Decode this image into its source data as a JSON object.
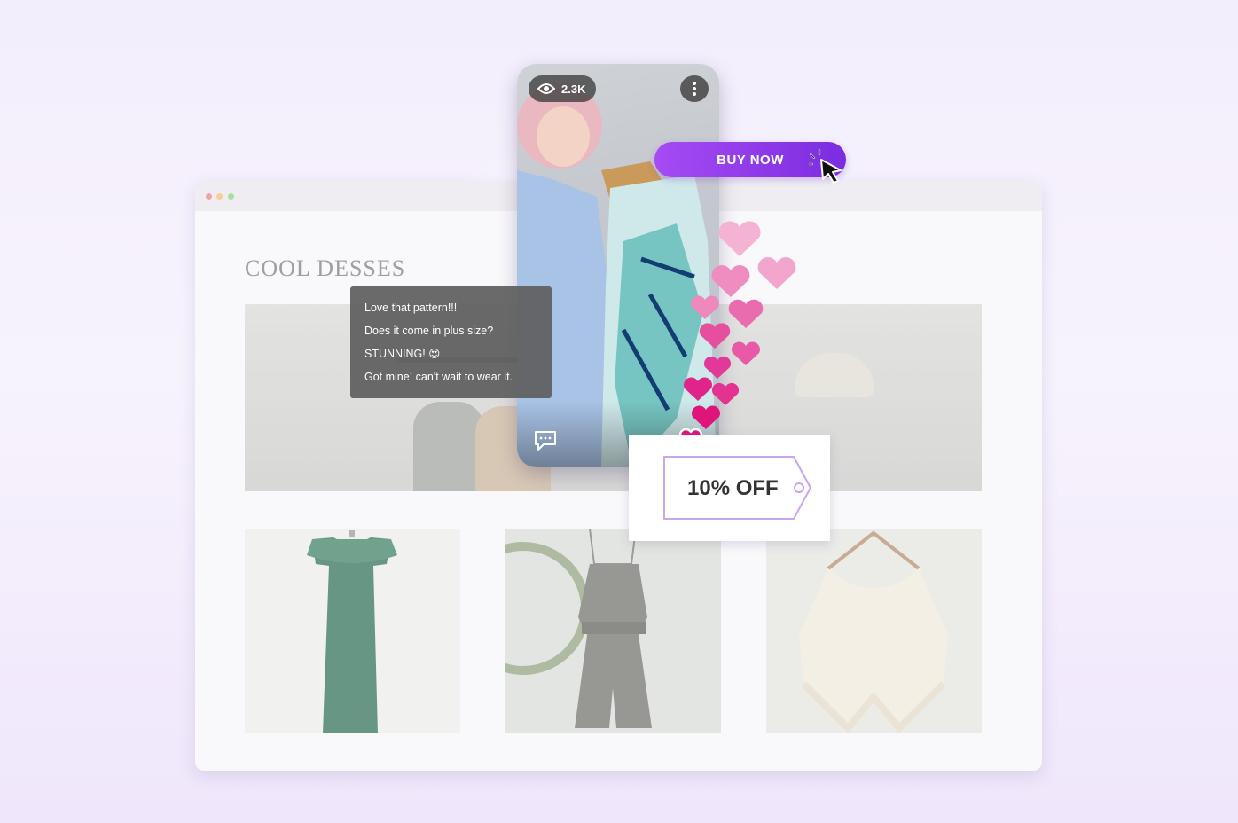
{
  "browser": {
    "page_title": "COOL DESSES"
  },
  "phone": {
    "views": "2.3K",
    "icons": [
      "eye-icon",
      "more-vertical-icon",
      "comment-icon",
      "heart-icon"
    ]
  },
  "comments": [
    "Love that pattern!!!",
    "Does it come in plus size?",
    "STUNNING! 😍",
    "Got mine! can't wait to wear it."
  ],
  "buy_button": {
    "label": "BUY NOW"
  },
  "coupon": {
    "label": "10% OFF"
  },
  "colors": {
    "accent_start": "#a64bf4",
    "accent_end": "#7b2ce0",
    "heart_pink": "#e0157a",
    "heart_light": "#f5a8cf",
    "coupon_outline": "#c8a6ef"
  }
}
